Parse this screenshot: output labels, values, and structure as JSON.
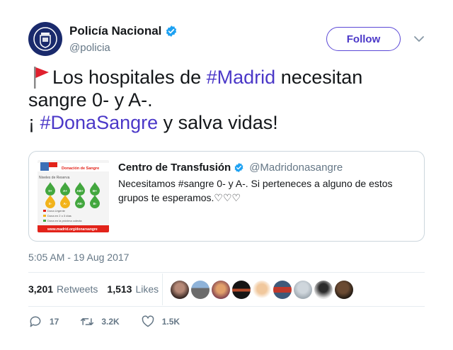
{
  "author": {
    "name": "Policía Nacional",
    "handle": "@policia",
    "follow_label": "Follow"
  },
  "tweet": {
    "line1_pre": "Los hospitales de ",
    "line1_tag": "#Madrid",
    "line1_post": " necesitan",
    "line2": "sangre 0- y A-.",
    "line3_pre": "¡ ",
    "line3_tag": "#DonaSangre",
    "line3_post": " y salva vidas!"
  },
  "quote": {
    "name": "Centro de Transfusión",
    "handle": "@Madridonasangre",
    "text": "Necesitamos #sangre 0- y A-. Si perteneces a alguno de estos grupos te esperamos.♡♡♡",
    "image": {
      "header": "Donación de Sangre",
      "subtitle": "Niveles de Reserva",
      "drops": [
        "0+",
        "A+",
        "AB+",
        "B+",
        "0-",
        "A-",
        "AB-",
        "B-"
      ],
      "legend": [
        "Dona Urgente",
        "Dona en 2 o 3 días",
        "Dona en la próxima colecta"
      ],
      "footer": "www.madrid.org/donarsangre"
    }
  },
  "timestamp": "5:05 AM - 19 Aug 2017",
  "stats": {
    "retweets_count": "3,201",
    "retweets_label": "Retweets",
    "likes_count": "1,513",
    "likes_label": "Likes"
  },
  "actions": {
    "reply_count": "17",
    "retweet_count": "3.2K",
    "like_count": "1.5K"
  },
  "colors": {
    "accent": "#4b38c8",
    "muted": "#657786",
    "border": "#e6ecf0",
    "verified": "#1da1f2"
  }
}
